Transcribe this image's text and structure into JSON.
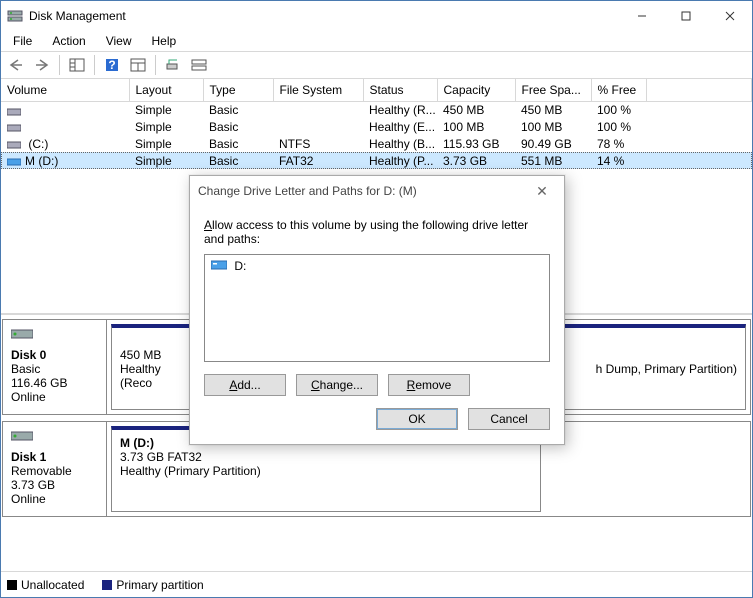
{
  "window": {
    "title": "Disk Management",
    "min": "—",
    "max": "☐",
    "close": "✕"
  },
  "menu": {
    "file": "File",
    "action": "Action",
    "view": "View",
    "help": "Help"
  },
  "columns": {
    "volume": "Volume",
    "layout": "Layout",
    "type": "Type",
    "filesystem": "File System",
    "status": "Status",
    "capacity": "Capacity",
    "freespace": "Free Spa...",
    "pctfree": "% Free"
  },
  "rows": [
    {
      "volume": "",
      "layout": "Simple",
      "type": "Basic",
      "fs": "",
      "status": "Healthy (R...",
      "cap": "450 MB",
      "free": "450 MB",
      "pct": "100 %"
    },
    {
      "volume": "",
      "layout": "Simple",
      "type": "Basic",
      "fs": "",
      "status": "Healthy (E...",
      "cap": "100 MB",
      "free": "100 MB",
      "pct": "100 %"
    },
    {
      "volume": " (C:)",
      "layout": "Simple",
      "type": "Basic",
      "fs": "NTFS",
      "status": "Healthy (B...",
      "cap": "115.93 GB",
      "free": "90.49 GB",
      "pct": "78 %"
    },
    {
      "volume": "M (D:)",
      "layout": "Simple",
      "type": "Basic",
      "fs": "FAT32",
      "status": "Healthy (P...",
      "cap": "3.73 GB",
      "free": "551 MB",
      "pct": "14 %"
    }
  ],
  "disk0": {
    "name": "Disk 0",
    "type": "Basic",
    "size": "116.46 GB",
    "status": "Online",
    "p1_size": "450 MB",
    "p1_status": "Healthy (Reco",
    "p_tail": "h Dump, Primary Partition)"
  },
  "disk1": {
    "name": "Disk 1",
    "type": "Removable",
    "size": "3.73 GB",
    "status": "Online",
    "p_label": "M  (D:)",
    "p_sizefs": "3.73 GB FAT32",
    "p_status": "Healthy (Primary Partition)"
  },
  "legend": {
    "unalloc": "Unallocated",
    "primary": "Primary partition"
  },
  "dialog": {
    "title": "Change Drive Letter and Paths for D: (M)",
    "instruction": "Allow access to this volume by using the following drive letter and paths:",
    "entry": "D:",
    "add": "Add...",
    "change": "Change...",
    "remove": "Remove",
    "ok": "OK",
    "cancel": "Cancel"
  }
}
